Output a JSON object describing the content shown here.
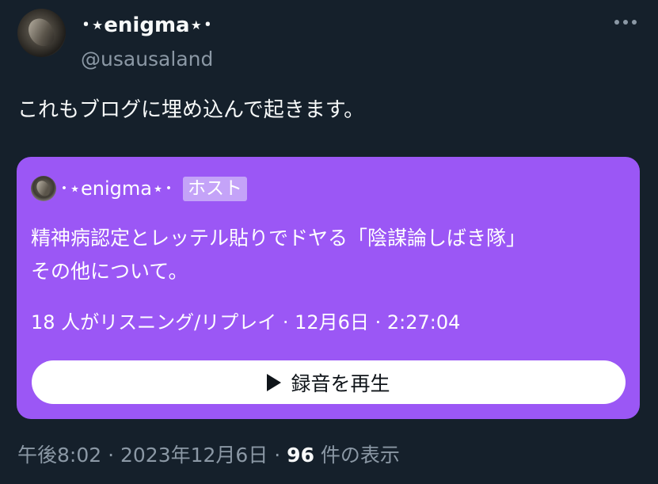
{
  "author": {
    "display_name": "･⋆enigma⋆･",
    "handle": "@usausaland",
    "avatar_icon": "rabbit-avatar"
  },
  "more_icon": "more-horizontal-icon",
  "tweet_text": "これもブログに埋め込んで起きます。",
  "space_card": {
    "background_color": "#9b57f5",
    "host_name": "･⋆enigma⋆･",
    "host_badge": "ホスト",
    "title_line1": "精神病認定とレッテル貼りでドヤる「陰謀論しばき隊」",
    "title_line2": "その他について。",
    "meta": "18 人がリスニング/リプレイ · 12月6日 · 2:27:04",
    "play_label": "録音を再生",
    "play_icon": "play-icon"
  },
  "footer": {
    "time": "午後8:02",
    "sep1": " · ",
    "date": "2023年12月6日",
    "sep2": " · ",
    "views_count": "96",
    "views_label": " 件の表示"
  }
}
